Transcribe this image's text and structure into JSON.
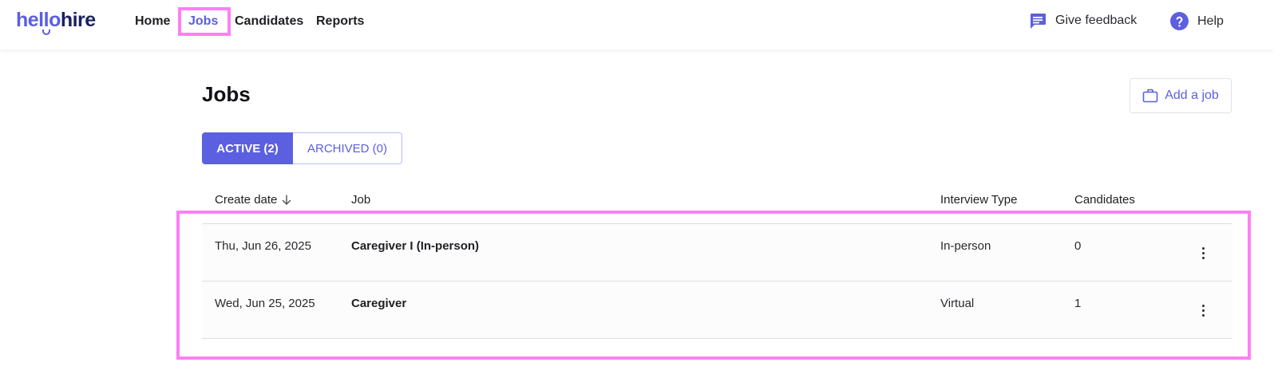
{
  "brand": {
    "logo_part1": "hello",
    "logo_part2": "hire",
    "primary_color": "#5b5fe0",
    "dark_color": "#1c2260",
    "highlight_color": "#ff7ff3"
  },
  "nav": {
    "items": [
      {
        "label": "Home",
        "active": false
      },
      {
        "label": "Jobs",
        "active": true
      },
      {
        "label": "Candidates",
        "active": false
      },
      {
        "label": "Reports",
        "active": false
      }
    ],
    "feedback_label": "Give feedback",
    "feedback_icon": "chat-bubble-icon",
    "help_label": "Help",
    "help_icon": "question-circle-icon"
  },
  "page": {
    "title": "Jobs",
    "add_job_label": "Add a job",
    "add_job_icon": "briefcase-icon"
  },
  "tabs": [
    {
      "label": "ACTIVE (2)",
      "active": true
    },
    {
      "label": "ARCHIVED (0)",
      "active": false
    }
  ],
  "table": {
    "columns": [
      "Create date",
      "Job",
      "Interview Type",
      "Candidates"
    ],
    "sort_icon": "arrow-down-icon",
    "rows": [
      {
        "create_date": "Thu, Jun 26, 2025",
        "job": "Caregiver I (In-person)",
        "interview_type": "In-person",
        "candidates": "0"
      },
      {
        "create_date": "Wed, Jun 25, 2025",
        "job": "Caregiver",
        "interview_type": "Virtual",
        "candidates": "1"
      }
    ]
  }
}
